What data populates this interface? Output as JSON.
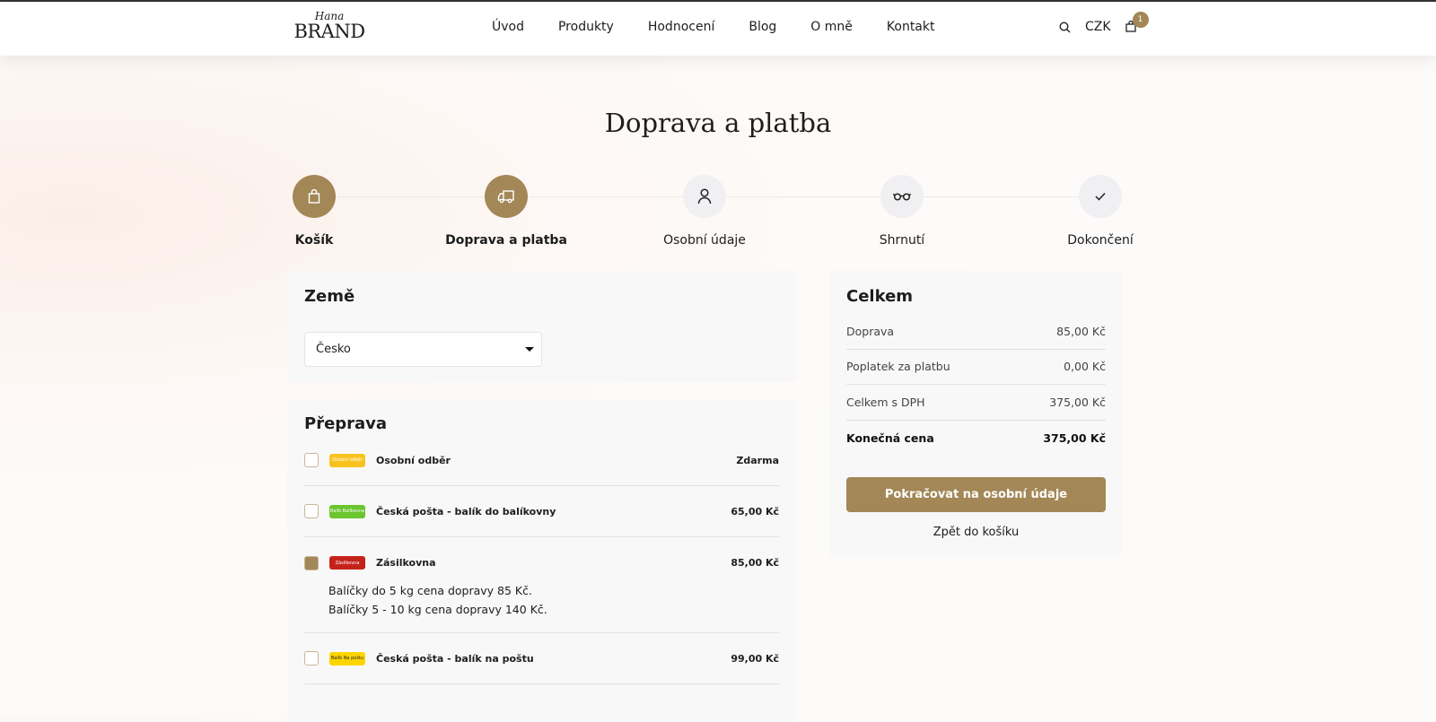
{
  "header": {
    "logo_script": "Hana",
    "logo_brand": "BRAND",
    "nav": [
      "Úvod",
      "Produkty",
      "Hodnocení",
      "Blog",
      "O mně",
      "Kontakt"
    ],
    "currency": "CZK",
    "cart_count": "1"
  },
  "page_title": "Doprava a platba",
  "steps": [
    {
      "label": "Košík",
      "icon": "bag-icon"
    },
    {
      "label": "Doprava a platba",
      "icon": "truck-icon"
    },
    {
      "label": "Osobní údaje",
      "icon": "user-icon"
    },
    {
      "label": "Shrnutí",
      "icon": "glasses-icon"
    },
    {
      "label": "Dokončení",
      "icon": "check-icon"
    }
  ],
  "country": {
    "title": "Země",
    "selected": "Česko"
  },
  "shipping": {
    "title": "Přeprava",
    "options": [
      {
        "name": "Osobní odběr",
        "price": "Zdarma",
        "logo": "Osobní odběr",
        "logo_color": "#f9c31f",
        "checked": false
      },
      {
        "name": "Česká pošta - balík do balíkovny",
        "price": "65,00 Kč",
        "logo": "Balík Balíkovna",
        "logo_color": "#6bc52d",
        "checked": false
      },
      {
        "name": "Zásilkovna",
        "price": "85,00 Kč",
        "logo": "Zásilkovna",
        "logo_color": "#c4231b",
        "checked": true,
        "description": [
          "Balíčky do 5 kg cena dopravy 85 Kč.",
          "Balíčky 5 - 10 kg cena dopravy 140 Kč."
        ]
      },
      {
        "name": "Česká pošta - balík na poštu",
        "price": "99,00 Kč",
        "logo": "Balík Na poštu",
        "logo_color": "#ffd500",
        "checked": false
      }
    ]
  },
  "summary": {
    "title": "Celkem",
    "rows": [
      {
        "label": "Doprava",
        "value": "85,00 Kč"
      },
      {
        "label": "Poplatek za platbu",
        "value": "0,00 Kč"
      },
      {
        "label": "Celkem s DPH",
        "value": "375,00 Kč"
      },
      {
        "label": "Konečná cena",
        "value": "375,00 Kč"
      }
    ],
    "continue": "Pokračovat na osobní údaje",
    "back": "Zpět do košíku"
  }
}
